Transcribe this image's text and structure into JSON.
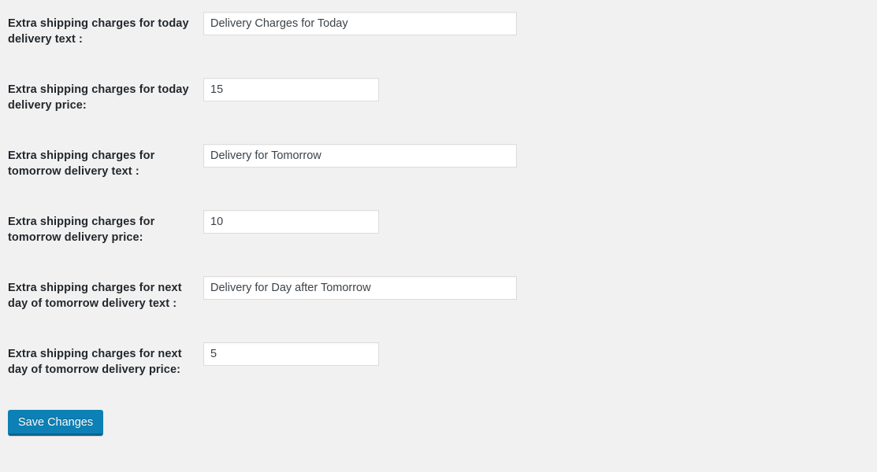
{
  "page": {
    "background_color": "#f1f1f1",
    "label_color": "#23282d",
    "accent_color": "#0d80b5"
  },
  "form": {
    "rows": [
      {
        "label": "Extra shipping charges for today delivery text :",
        "value": "Delivery Charges for Today",
        "placeholder": "Delivery Charges for Today",
        "field_type": "text",
        "size": "wide"
      },
      {
        "label": "Extra shipping charges for today delivery price:",
        "value": "15",
        "placeholder": "15",
        "field_type": "number",
        "size": "narrow"
      },
      {
        "label": "Extra shipping charges for tomorrow delivery text :",
        "value": "Delivery for Tomorrow",
        "placeholder": "Delivery for Tomorrow",
        "field_type": "text",
        "size": "wide"
      },
      {
        "label": "Extra shipping charges for tomorrow delivery price:",
        "value": "10",
        "placeholder": "10",
        "field_type": "number",
        "size": "narrow"
      },
      {
        "label": "Extra shipping charges for next day of tomorrow delivery text :",
        "value": "Delivery for Day after Tomorrow",
        "placeholder": "Delivery for Day after Tomorrow",
        "field_type": "text",
        "size": "wide"
      },
      {
        "label": "Extra shipping charges for next day of tomorrow delivery price:",
        "value": "5",
        "placeholder": "5",
        "field_type": "number",
        "size": "narrow"
      }
    ]
  },
  "submit": {
    "save_label": "Save Changes"
  }
}
